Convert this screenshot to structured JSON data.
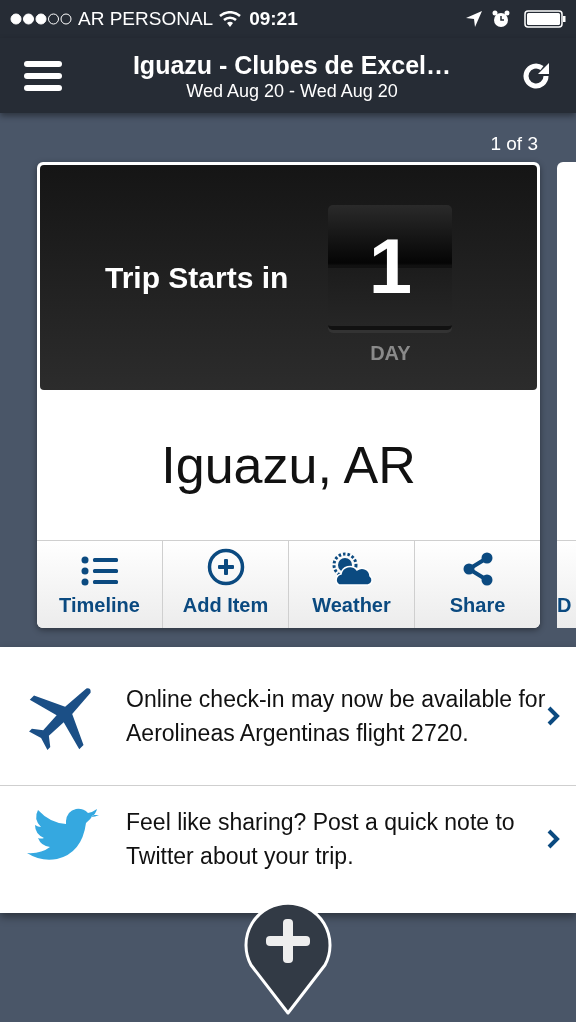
{
  "status_bar": {
    "carrier": "AR PERSONAL",
    "time": "09:21"
  },
  "nav": {
    "title": "Iguazu - Clubes de Excel…",
    "subtitle": "Wed Aug 20 - Wed Aug 20"
  },
  "pager": "1 of 3",
  "trip_card": {
    "countdown_label": "Trip Starts in",
    "count": "1",
    "unit": "DAY",
    "location": "Iguazu, AR",
    "actions": [
      {
        "kind": "timeline",
        "label": "Timeline"
      },
      {
        "kind": "add",
        "label": "Add Item"
      },
      {
        "kind": "weather",
        "label": "Weather"
      },
      {
        "kind": "share",
        "label": "Share"
      }
    ]
  },
  "next_card": {
    "action_label": "D"
  },
  "notifications": [
    {
      "kind": "flight",
      "text": "Online check-in may now be available for Aerolineas Argentinas flight 2720."
    },
    {
      "kind": "twitter",
      "text": "Feel like sharing? Post a quick note to Twitter about your trip."
    }
  ]
}
